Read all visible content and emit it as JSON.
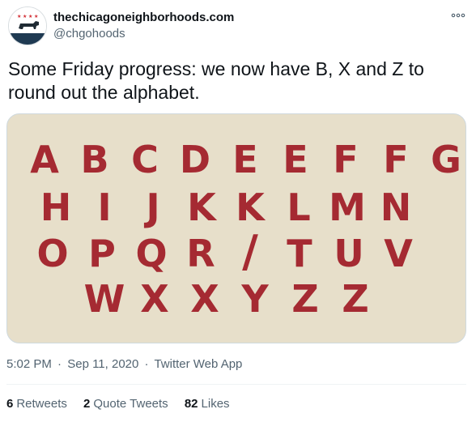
{
  "tweet": {
    "display_name": "thechicagoneighborhoods.com",
    "handle": "@chgohoods",
    "text": "Some Friday progress: we now have B, X and Z to round out the alphabet.",
    "time": "5:02 PM",
    "date": "Sep 11, 2020",
    "source": "Twitter Web App",
    "separator": "·"
  },
  "stats": {
    "retweets": {
      "count": "6",
      "label": "Retweets"
    },
    "quote_tweets": {
      "count": "2",
      "label": "Quote Tweets"
    },
    "likes": {
      "count": "82",
      "label": "Likes"
    }
  },
  "image": {
    "rows": [
      [
        "A",
        "B",
        "C",
        "D",
        "E",
        "E",
        "F",
        "F",
        "G"
      ],
      [
        "H",
        "I",
        "J",
        "K",
        "K",
        "L",
        "M",
        "N"
      ],
      [
        "O",
        "P",
        "Q",
        "R",
        "/",
        "T",
        "U",
        "V"
      ],
      [
        "W",
        "X",
        "X",
        "Y",
        "Z",
        "Z"
      ]
    ],
    "letter_color": "#a52a32",
    "background_color": "#e7dfca"
  },
  "icons": {
    "avatar": "chicago-flag-cow-icon",
    "more": "more-dots-icon"
  },
  "colors": {
    "text": "#0f1419",
    "secondary": "#536471",
    "border": "#cfd9de"
  }
}
